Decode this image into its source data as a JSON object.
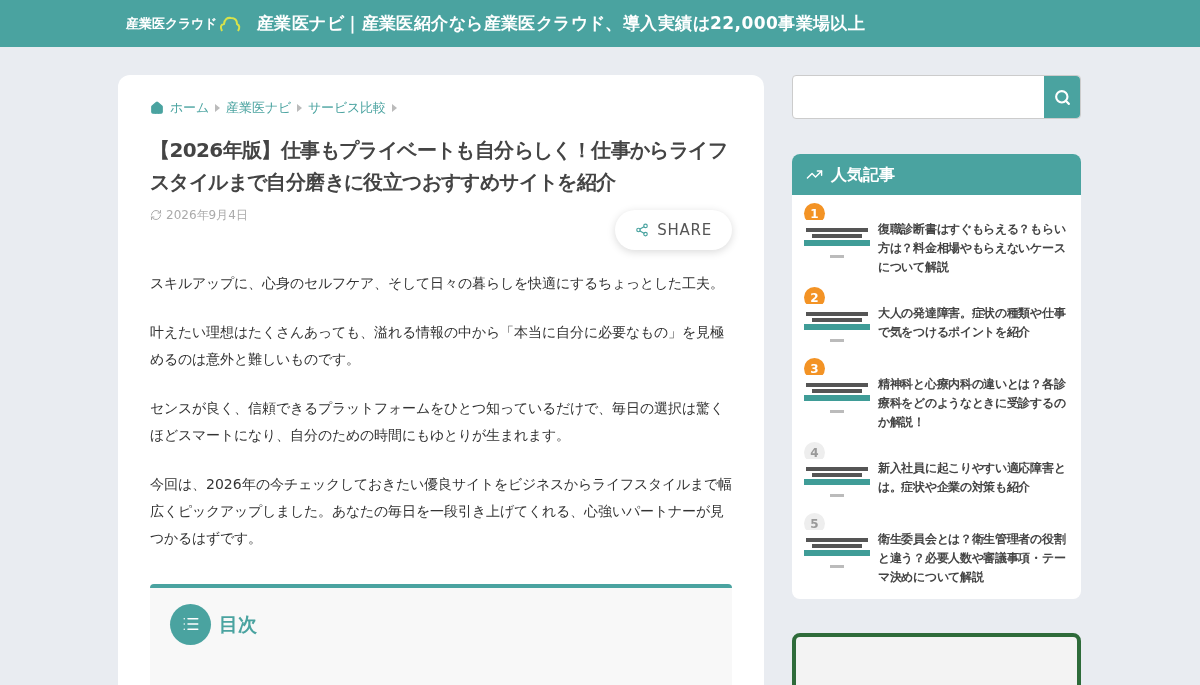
{
  "header": {
    "logo": "産業医クラウド",
    "title": "産業医ナビ｜産業医紹介なら産業医クラウド、導入実績は22,000事業場以上"
  },
  "breadcrumb": [
    "ホーム",
    "産業医ナビ",
    "サービス比較"
  ],
  "article": {
    "title": "【2026年版】仕事もプライベートも自分らしく！仕事からライフスタイルまで自分磨きに役立つおすすめサイトを紹介",
    "date": "2026年9月4日",
    "share": "SHARE",
    "paragraphs": [
      "スキルアップに、心身のセルフケア、そして日々の暮らしを快適にするちょっとした工夫。",
      "叶えたい理想はたくさんあっても、溢れる情報の中から「本当に自分に必要なもの」を見極めるのは意外と難しいものです。",
      "センスが良く、信頼できるプラットフォームをひとつ知っているだけで、毎日の選択は驚くほどスマートになり、自分のための時間にもゆとりが生まれます。",
      "今回は、2026年の今チェックしておきたい優良サイトをビジネスからライフスタイルまで幅広くピックアップしました。あなたの毎日を一段引き上げてくれる、心強いパートナーが見つかるはずです。"
    ],
    "toc": {
      "title": "目次"
    }
  },
  "sidebar": {
    "popular": {
      "title": "人気記事",
      "items": [
        {
          "rank": "1",
          "color": "#f39325",
          "title": "復職診断書はすぐもらえる？もらい方は？料金相場やもらえないケースについて解説"
        },
        {
          "rank": "2",
          "color": "#f39325",
          "title": "大人の発達障害。症状の種類や仕事で気をつけるポイントを紹介"
        },
        {
          "rank": "3",
          "color": "#f39325",
          "title": "精神科と心療内科の違いとは？各診療科をどのようなときに受診するのか解説！"
        },
        {
          "rank": "4",
          "color": "#eeeeee",
          "title": "新入社員に起こりやすい適応障害とは。症状や企業の対策も紹介"
        },
        {
          "rank": "5",
          "color": "#eeeeee",
          "title": "衛生委員会とは？衛生管理者の役割と違う？必要人数や審議事項・テーマ決めについて解説"
        }
      ]
    }
  }
}
